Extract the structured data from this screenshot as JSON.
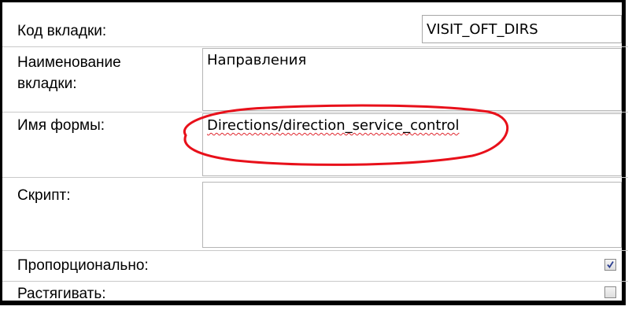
{
  "form": {
    "tab_code": {
      "label": "Код вкладки:",
      "value": "VISIT_OFT_DIRS"
    },
    "tab_name": {
      "label_line1": "Наименование",
      "label_line2": "вкладки:",
      "value": "Направления"
    },
    "form_name": {
      "label": "Имя формы:",
      "value": "Directions/direction_service_control"
    },
    "script": {
      "label": "Скрипт:",
      "value": ""
    },
    "proportional": {
      "label": "Пропорционально:",
      "checked": true
    },
    "stretch": {
      "label": "Растягивать:",
      "checked": false
    }
  },
  "annotation": {
    "color": "#e8101a"
  }
}
